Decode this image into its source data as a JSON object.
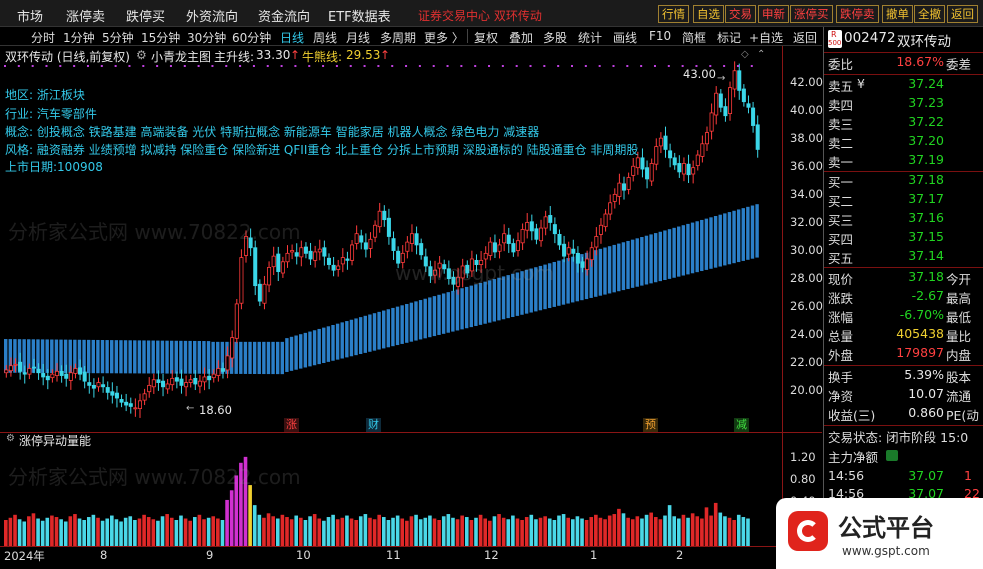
{
  "menu": {
    "items": [
      "市场",
      "涨停卖",
      "跌停买",
      "外资流向",
      "资金流向",
      "ETF数据表"
    ],
    "ticker": "证券交易中心 双环传动"
  },
  "top_buttons": [
    "行情",
    "自选",
    "交易",
    "申新",
    "涨停买",
    "跌停卖",
    "撤单",
    "全撤",
    "返回"
  ],
  "toolbar": {
    "periods": [
      "分时",
      "1分钟",
      "5分钟",
      "15分钟",
      "30分钟",
      "60分钟",
      "日线",
      "周线",
      "月线",
      "多周期",
      "更多 〉"
    ],
    "active": "日线",
    "tools": [
      "复权",
      "叠加",
      "多股",
      "统计",
      "画线",
      "F10",
      "简框",
      "标记",
      "+自选",
      "返回"
    ]
  },
  "chart": {
    "header": {
      "name": "双环传动 (日线,前复权)",
      "indicator": "小青龙主图",
      "rising_label": "主升线:",
      "rising_value": "33.30",
      "rising_arrow": "↑",
      "bull_label": "牛熊线:",
      "bull_value": "29.53",
      "bull_arrow": "↑"
    },
    "info": {
      "region": "地区:  浙江板块",
      "industry": "行业:  汽车零部件",
      "concept": "概念:  创投概念 铁路基建 高端装备 光伏 特斯拉概念 新能源车 智能家居 机器人概念 绿色电力 减速器",
      "style": "风格:  融资融券 业绩预增 拟减持 保险重仓 保险新进 QFII重仓 北上重仓 分拆上市预期 深股通标的 陆股通重仓 非周期股",
      "listing": "上市日期:100908"
    },
    "price_labels": {
      "high": "43.00",
      "low": "18.60"
    },
    "markers": {
      "zhang": "涨",
      "cai": "财",
      "yu": "预",
      "jian": "减"
    },
    "watermarks": [
      "分析家公式网 www.70822.com",
      "www.gsgpt.com"
    ],
    "sub_title": "涨停异动量能",
    "x_labels": [
      "2024年",
      "8",
      "9",
      "10",
      "11",
      "12",
      "1",
      "2"
    ]
  },
  "chart_data": {
    "type": "candlestick",
    "y_axis_main": [
      "42.00",
      "40.00",
      "38.00",
      "36.00",
      "34.00",
      "32.00",
      "30.00",
      "28.00",
      "26.00",
      "24.00",
      "22.00",
      "20.00"
    ],
    "y_axis_sub": [
      "1.20",
      "0.80",
      "0.40"
    ],
    "closes": [
      21.5,
      21.8,
      21.9,
      21.4,
      21.2,
      21.6,
      21.7,
      21.3,
      21.0,
      20.8,
      21.2,
      21.4,
      21.1,
      20.9,
      21.3,
      21.6,
      21.2,
      20.7,
      20.4,
      20.2,
      20.6,
      20.3,
      19.9,
      19.7,
      19.5,
      19.2,
      19.0,
      18.9,
      18.8,
      19.3,
      19.8,
      20.4,
      20.8,
      20.6,
      20.3,
      20.5,
      20.9,
      20.7,
      20.4,
      20.6,
      20.8,
      20.5,
      20.7,
      21.0,
      20.8,
      21.2,
      21.6,
      21.4,
      22.5,
      23.8,
      26.2,
      29.5,
      31.0,
      30.2,
      27.5,
      26.4,
      27.6,
      28.8,
      29.6,
      28.5,
      29.2,
      29.8,
      30.0,
      29.6,
      30.2,
      29.8,
      29.4,
      29.9,
      30.1,
      29.6,
      29.0,
      28.6,
      28.9,
      29.5,
      29.3,
      30.4,
      31.2,
      30.6,
      30.1,
      30.8,
      31.8,
      32.8,
      32.2,
      31.0,
      30.0,
      29.1,
      29.8,
      30.6,
      31.2,
      30.4,
      29.7,
      28.9,
      28.2,
      28.6,
      29.1,
      28.7,
      28.0,
      27.6,
      28.1,
      28.9,
      28.4,
      29.4,
      29.0,
      29.3,
      29.8,
      30.6,
      29.9,
      30.4,
      31.2,
      30.5,
      29.9,
      30.7,
      31.5,
      32.0,
      31.4,
      30.8,
      31.6,
      32.4,
      32.0,
      31.2,
      30.4,
      29.6,
      30.2,
      29.8,
      29.1,
      28.8,
      29.4,
      30.2,
      31.0,
      31.8,
      32.6,
      33.4,
      34.0,
      34.8,
      34.3,
      35.2,
      36.0,
      36.6,
      35.8,
      35.1,
      36.2,
      37.4,
      38.0,
      37.2,
      36.6,
      36.1,
      35.6,
      36.2,
      35.4,
      35.9,
      36.8,
      37.6,
      38.4,
      39.8,
      41.2,
      40.2,
      39.6,
      41.6,
      42.8,
      41.4,
      40.6,
      40.2,
      38.9,
      37.2
    ],
    "band_start": [
      23.7,
      21.3
    ],
    "band_end": [
      33.3,
      29.5
    ],
    "volumes": [
      0.35,
      0.38,
      0.42,
      0.36,
      0.33,
      0.4,
      0.44,
      0.37,
      0.34,
      0.38,
      0.41,
      0.39,
      0.36,
      0.33,
      0.4,
      0.43,
      0.37,
      0.35,
      0.39,
      0.42,
      0.38,
      0.34,
      0.37,
      0.41,
      0.36,
      0.33,
      0.38,
      0.4,
      0.35,
      0.37,
      0.42,
      0.39,
      0.36,
      0.34,
      0.4,
      0.43,
      0.38,
      0.35,
      0.41,
      0.37,
      0.34,
      0.39,
      0.42,
      0.36,
      0.38,
      0.4,
      0.37,
      0.35,
      0.62,
      0.75,
      0.95,
      1.12,
      1.2,
      0.82,
      0.55,
      0.42,
      0.38,
      0.44,
      0.4,
      0.37,
      0.42,
      0.39,
      0.36,
      0.41,
      0.38,
      0.35,
      0.4,
      0.43,
      0.37,
      0.34,
      0.39,
      0.42,
      0.36,
      0.38,
      0.41,
      0.37,
      0.35,
      0.4,
      0.43,
      0.38,
      0.36,
      0.42,
      0.39,
      0.35,
      0.38,
      0.41,
      0.37,
      0.34,
      0.4,
      0.42,
      0.36,
      0.38,
      0.41,
      0.37,
      0.35,
      0.4,
      0.43,
      0.38,
      0.36,
      0.41,
      0.39,
      0.35,
      0.38,
      0.42,
      0.37,
      0.34,
      0.4,
      0.43,
      0.38,
      0.36,
      0.41,
      0.37,
      0.35,
      0.39,
      0.42,
      0.36,
      0.38,
      0.4,
      0.37,
      0.35,
      0.41,
      0.43,
      0.38,
      0.36,
      0.4,
      0.37,
      0.35,
      0.39,
      0.42,
      0.38,
      0.36,
      0.41,
      0.43,
      0.5,
      0.44,
      0.38,
      0.36,
      0.4,
      0.37,
      0.42,
      0.45,
      0.39,
      0.36,
      0.41,
      0.55,
      0.4,
      0.37,
      0.42,
      0.38,
      0.44,
      0.4,
      0.37,
      0.52,
      0.41,
      0.58,
      0.45,
      0.4,
      0.38,
      0.35,
      0.42,
      0.39,
      0.37
    ]
  },
  "quote": {
    "code": "002472",
    "name": "双环传动",
    "badge_r": "R",
    "badge_n": "500",
    "weibi_label": "委比",
    "weibi": "18.67%",
    "weicha_label": "委差",
    "asks": [
      {
        "label": "卖五",
        "price": "37.24",
        "mark": "¥"
      },
      {
        "label": "卖四",
        "price": "37.23"
      },
      {
        "label": "卖三",
        "price": "37.22"
      },
      {
        "label": "卖二",
        "price": "37.20"
      },
      {
        "label": "卖一",
        "price": "37.19"
      }
    ],
    "bids": [
      {
        "label": "买一",
        "price": "37.18"
      },
      {
        "label": "买二",
        "price": "37.17"
      },
      {
        "label": "买三",
        "price": "37.16"
      },
      {
        "label": "买四",
        "price": "37.15"
      },
      {
        "label": "买五",
        "price": "37.14"
      }
    ],
    "stats": [
      {
        "label": "现价",
        "value": "37.18",
        "color": "grn",
        "right": "今开"
      },
      {
        "label": "涨跌",
        "value": "-2.67",
        "color": "grn",
        "right": "最高"
      },
      {
        "label": "涨幅",
        "value": "-6.70%",
        "color": "grn",
        "right": "最低"
      },
      {
        "label": "总量",
        "value": "405438",
        "color": "yel",
        "right": "量比"
      },
      {
        "label": "外盘",
        "value": "179897",
        "color": "red",
        "right": "内盘"
      },
      {
        "label": "换手",
        "value": "5.39%",
        "color": "wht",
        "right": "股本"
      },
      {
        "label": "净资",
        "value": "10.07",
        "color": "wht",
        "right": "流通"
      },
      {
        "label": "收益(三)",
        "value": "0.860",
        "color": "wht",
        "right": "PE(动"
      }
    ],
    "trade_status": "交易状态: 闭市阶段 15:0",
    "main_flow": "主力净额",
    "ticks": [
      {
        "time": "14:56",
        "price": "37.07",
        "vol": "1"
      },
      {
        "time": "14:56",
        "price": "37.07",
        "vol": "22"
      }
    ]
  },
  "logo": {
    "text": "公式平台",
    "url": "www.gspt.com"
  }
}
